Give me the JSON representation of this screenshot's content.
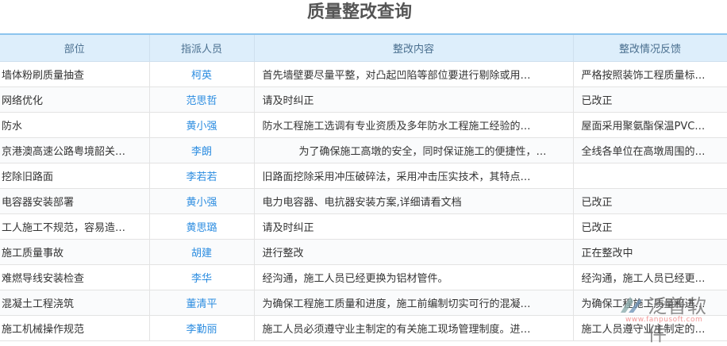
{
  "title": "质量整改查询",
  "columns": [
    "部位",
    "指派人员",
    "整改内容",
    "整改情况反馈"
  ],
  "rows": [
    {
      "part": "墙体粉刷质量抽查",
      "person": "柯英",
      "content": "首先墙壁要尽量平整，对凸起凹陷等部位要进行剔除或用…",
      "feedback": "严格按照装饰工程质量标…"
    },
    {
      "part": "网络优化",
      "person": "范思哲",
      "content": "请及时纠正",
      "feedback": "已改正"
    },
    {
      "part": "防水",
      "person": "黄小强",
      "content": "防水工程施工选调有专业资质及多年防水工程施工经验的…",
      "feedback": "屋面采用聚氨酯保温PVC…"
    },
    {
      "part": "京港澳高速公路粤境韶关…",
      "person": "李朗",
      "content": "为了确保施工高墩的安全，同时保证施工的便捷性，…",
      "feedback": "全线各单位在高墩周围的…"
    },
    {
      "part": "挖除旧路面",
      "person": "李若若",
      "content": "旧路面挖除采用冲压破碎法，采用冲击压实技术，其特点…",
      "feedback": ""
    },
    {
      "part": "电容器安装部署",
      "person": "黄小强",
      "content": "电力电容器、电抗器安装方案,详细请看文档",
      "feedback": "已改正"
    },
    {
      "part": "工人施工不规范，容易造…",
      "person": "黄思璐",
      "content": "请及时纠正",
      "feedback": "已改正"
    },
    {
      "part": "施工质量事故",
      "person": "胡建",
      "content": "进行整改",
      "feedback": "正在整改中"
    },
    {
      "part": "难燃导线安装检查",
      "person": "李华",
      "content": "经沟通，施工人员已经更换为铝材管件。",
      "feedback": "经沟通，施工人员已经更…"
    },
    {
      "part": "混凝土工程浇筑",
      "person": "董清平",
      "content": "为确保工程施工质量和进度，施工前编制切实可行的混凝…",
      "feedback": "为确保工程施工质量和进…"
    },
    {
      "part": "施工机械操作规范",
      "person": "李勤丽",
      "content": "施工人员必须遵守业主制定的有关施工现场管理制度。进…",
      "feedback": "施工人员遵守业主制定的…"
    }
  ],
  "watermark": {
    "name": "泛普软件",
    "url": "www.fanpusoft.com"
  }
}
